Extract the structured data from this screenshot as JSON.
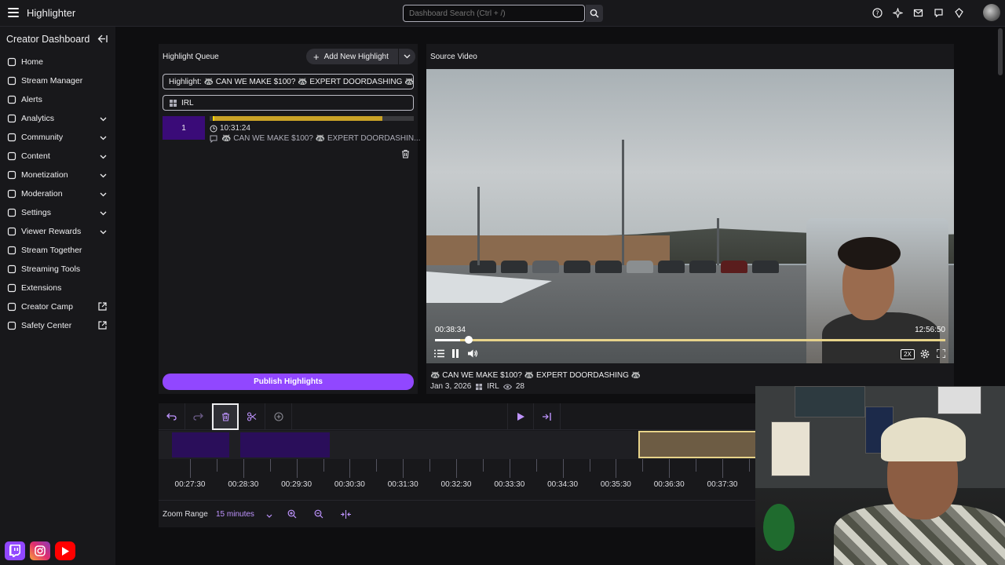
{
  "app": {
    "title": "Highlighter"
  },
  "search": {
    "placeholder": "Dashboard Search (Ctrl + /)"
  },
  "sidebar": {
    "heading": "Creator Dashboard",
    "items": [
      {
        "label": "Home",
        "icon": "home-icon",
        "chevron": false,
        "external": false
      },
      {
        "label": "Stream Manager",
        "icon": "stream-manager-icon",
        "chevron": false,
        "external": false
      },
      {
        "label": "Alerts",
        "icon": "bell-icon",
        "chevron": false,
        "external": false
      },
      {
        "label": "Analytics",
        "icon": "analytics-icon",
        "chevron": true,
        "external": false
      },
      {
        "label": "Community",
        "icon": "community-icon",
        "chevron": true,
        "external": false
      },
      {
        "label": "Content",
        "icon": "content-icon",
        "chevron": true,
        "external": false
      },
      {
        "label": "Monetization",
        "icon": "monetization-icon",
        "chevron": true,
        "external": false
      },
      {
        "label": "Moderation",
        "icon": "sword-icon",
        "chevron": true,
        "external": false
      },
      {
        "label": "Settings",
        "icon": "gear-icon",
        "chevron": true,
        "external": false
      },
      {
        "label": "Viewer Rewards",
        "icon": "rewards-icon",
        "chevron": true,
        "external": false
      },
      {
        "label": "Stream Together",
        "icon": "stream-together-icon",
        "chevron": false,
        "external": false
      },
      {
        "label": "Streaming Tools",
        "icon": "tools-icon",
        "chevron": false,
        "external": false
      },
      {
        "label": "Extensions",
        "icon": "extensions-icon",
        "chevron": false,
        "external": false
      },
      {
        "label": "Creator Camp",
        "icon": "book-icon",
        "chevron": false,
        "external": true
      },
      {
        "label": "Safety Center",
        "icon": "shield-icon",
        "chevron": false,
        "external": true
      }
    ]
  },
  "queue": {
    "title": "Highlight Queue",
    "add_label": "Add New Highlight",
    "title_field": "Highlight: 🦝 CAN WE MAKE $100? 🦝 EXPERT DOORDASHING 🦝",
    "category_field": "IRL",
    "clip": {
      "number": "1",
      "time": "10:31:24",
      "title": "🦝 CAN WE MAKE $100? 🦝 EXPERT DOORDASHIN..."
    },
    "publish_label": "Publish Highlights"
  },
  "source": {
    "title": "Source Video",
    "current_time": "00:38:34",
    "total_time": "12:56:50",
    "speed": "2X",
    "video_title": "🦝 CAN WE MAKE $100? 🦝 EXPERT DOORDASHING 🦝",
    "date": "Jan 3, 2026",
    "category": "IRL",
    "views": "28"
  },
  "timeline": {
    "ticks": [
      "00:27:30",
      "00:28:30",
      "00:29:30",
      "00:30:30",
      "00:31:30",
      "00:32:30",
      "00:33:30",
      "00:34:30",
      "00:35:30",
      "00:36:30",
      "00:37:30"
    ],
    "zoom_label": "Zoom Range",
    "zoom_value": "15 minutes"
  },
  "colors": {
    "accent": "#9147ff",
    "segment": "#2a0e5a",
    "highlight": "#e7d38a"
  }
}
